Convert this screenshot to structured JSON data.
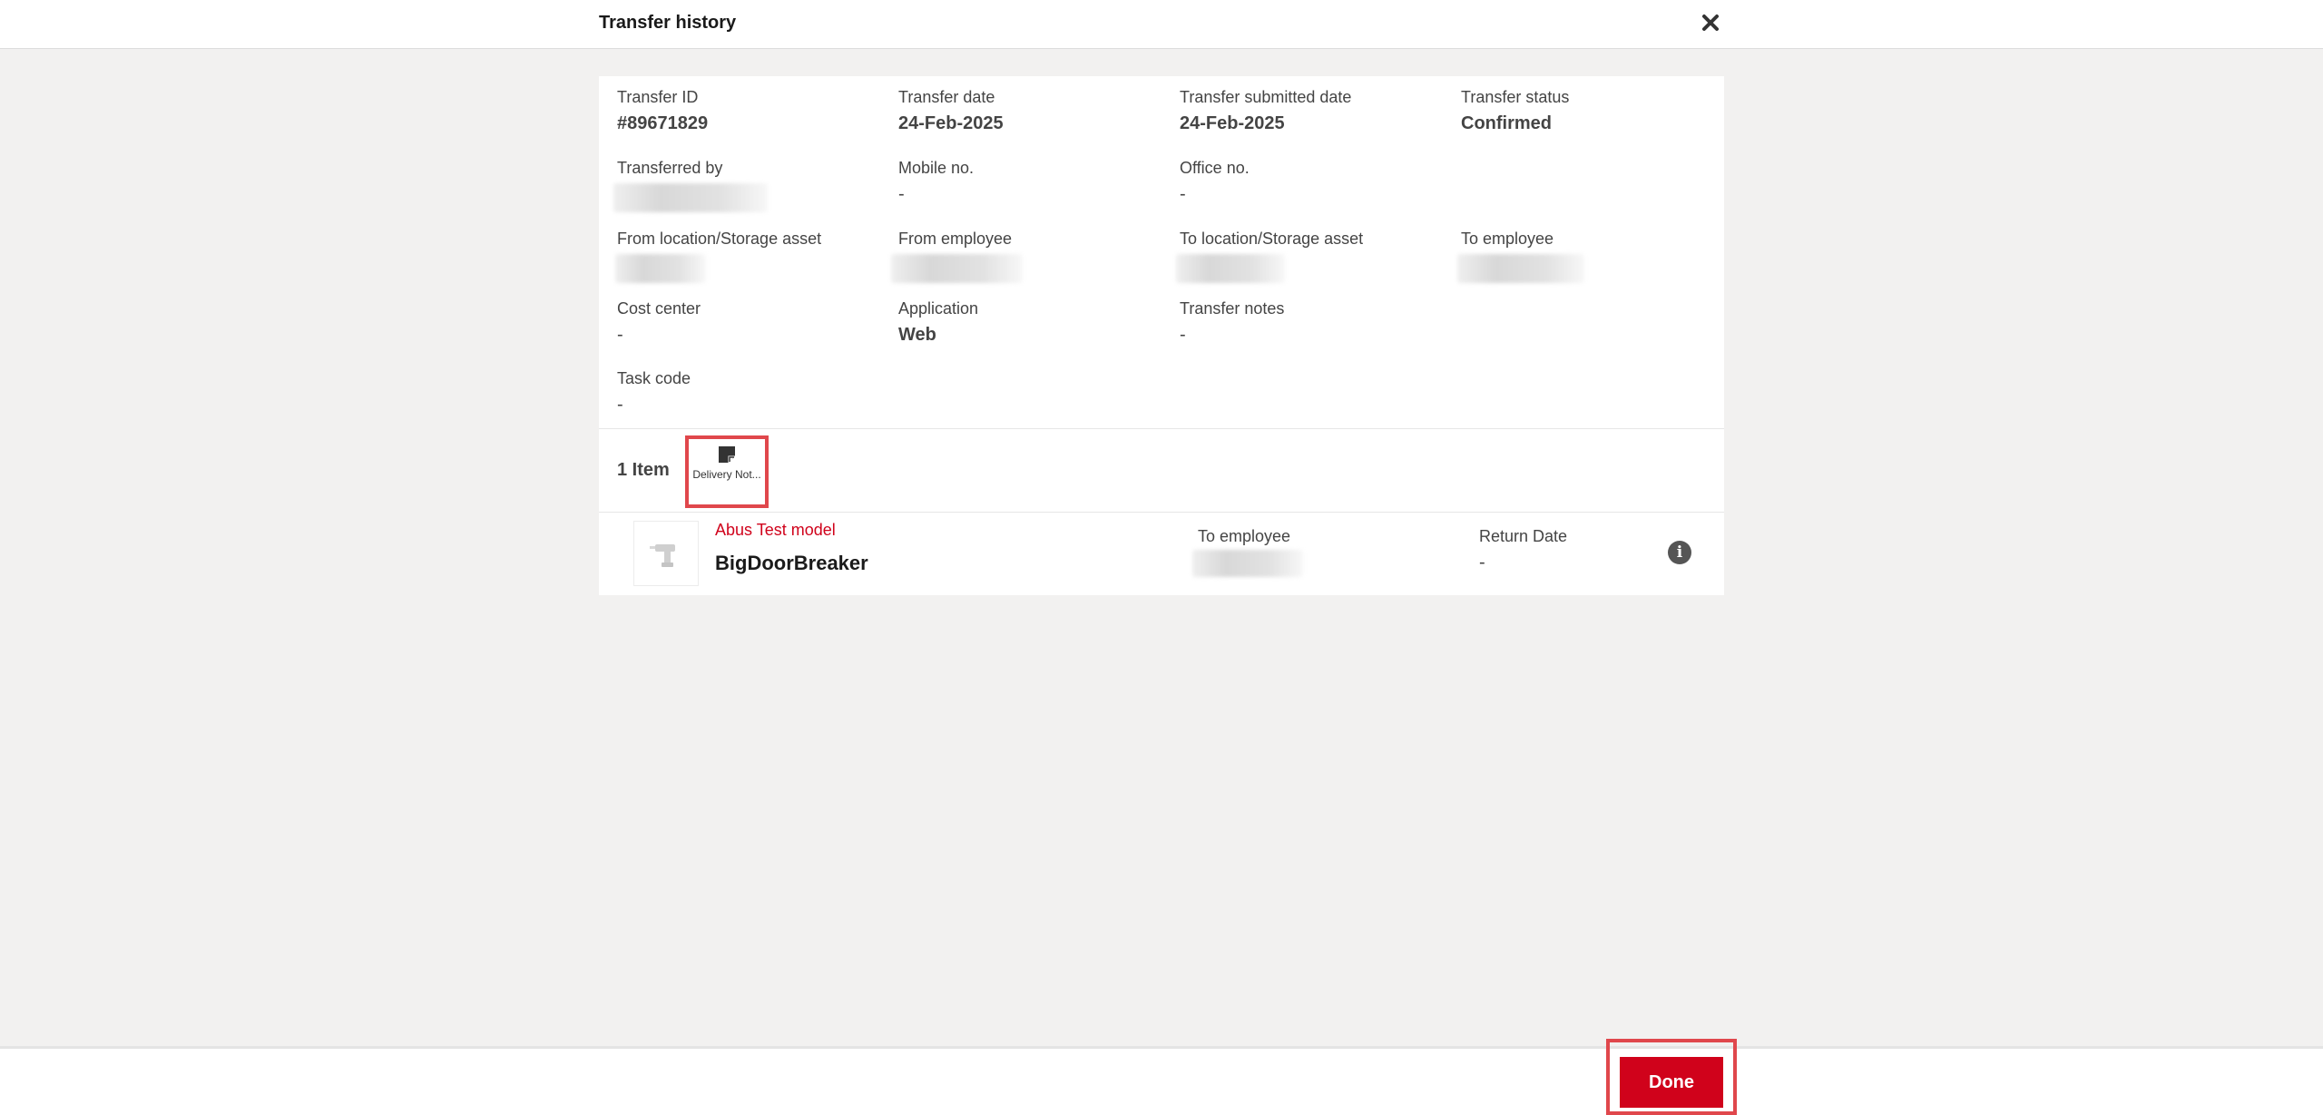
{
  "header": {
    "title": "Transfer history",
    "close_icon": "close-icon"
  },
  "details": {
    "transfer_id": {
      "label": "Transfer ID",
      "value": "#89671829"
    },
    "transfer_date": {
      "label": "Transfer date",
      "value": "24-Feb-2025"
    },
    "submitted_date": {
      "label": "Transfer submitted date",
      "value": "24-Feb-2025"
    },
    "transfer_status": {
      "label": "Transfer status",
      "value": "Confirmed"
    },
    "transferred_by": {
      "label": "Transferred by"
    },
    "mobile_no": {
      "label": "Mobile no.",
      "value": "-"
    },
    "office_no": {
      "label": "Office no.",
      "value": "-"
    },
    "from_location": {
      "label": "From location/Storage asset"
    },
    "from_employee": {
      "label": "From employee"
    },
    "to_location": {
      "label": "To location/Storage asset"
    },
    "to_employee": {
      "label": "To employee"
    },
    "cost_center": {
      "label": "Cost center",
      "value": "-"
    },
    "application": {
      "label": "Application",
      "value": "Web"
    },
    "transfer_notes": {
      "label": "Transfer notes",
      "value": "-"
    },
    "task_code": {
      "label": "Task code",
      "value": "-"
    }
  },
  "items": {
    "count_label": "1 Item",
    "delivery_note": {
      "label": "Delivery Not...",
      "icon": "note-icon"
    },
    "list": [
      {
        "model": "Abus Test model",
        "name": "BigDoorBreaker",
        "to_employee_label": "To employee",
        "return_date_label": "Return Date",
        "return_date_value": "-",
        "thumb_icon": "drill-icon",
        "info_icon": "info-icon"
      }
    ]
  },
  "footer": {
    "done_label": "Done"
  },
  "colors": {
    "accent": "#d0021b",
    "highlight": "#e0474c",
    "background": "#f2f1f0"
  }
}
